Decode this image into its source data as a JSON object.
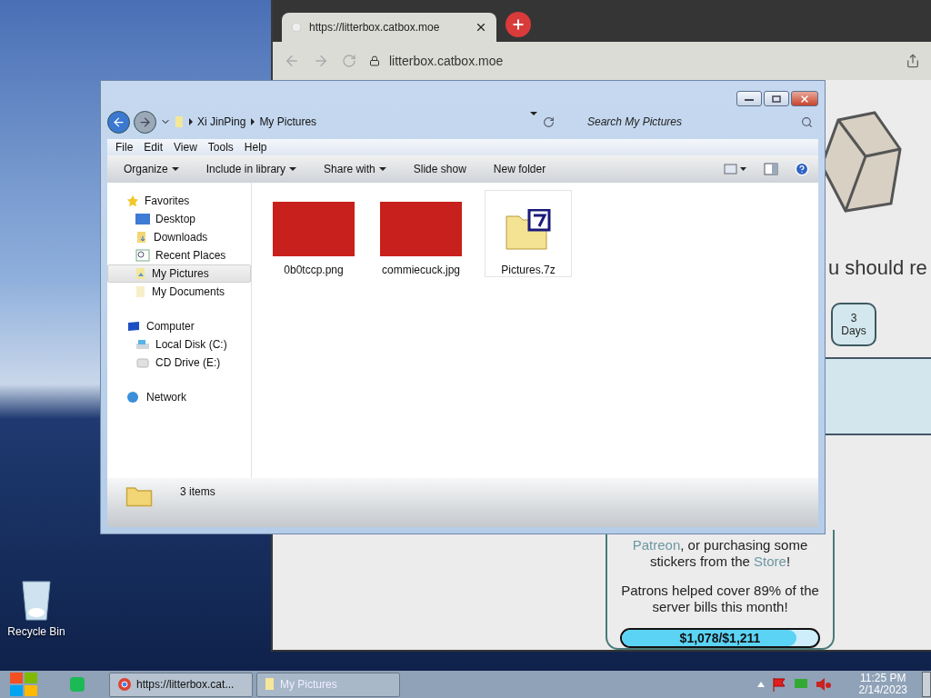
{
  "desktop": {
    "icons": [
      {
        "label": "Recycle Bin"
      }
    ]
  },
  "browser": {
    "tab": {
      "title": "https://litterbox.catbox.moe"
    },
    "address": "litterbox.catbox.moe",
    "page": {
      "heading": "u should re",
      "duration": {
        "number": "3",
        "unit": "Days"
      },
      "donation": {
        "segments": [
          {
            "kind": "link",
            "text": "Patreon"
          },
          {
            "kind": "plain",
            "text": ", or purchasing some stickers from the "
          },
          {
            "kind": "link",
            "text": "Store"
          },
          {
            "kind": "plain",
            "text": "!"
          }
        ],
        "patrons_note": "Patrons helped cover 89% of the server bills this month!",
        "progress": {
          "label": "$1,078/$1,211",
          "level": 0.89
        }
      }
    }
  },
  "explorer": {
    "breadcrumbs": [
      "Xi JinPing",
      "My Pictures"
    ],
    "search": {
      "placeholder": "Search My Pictures"
    },
    "menu": [
      "File",
      "Edit",
      "View",
      "Tools",
      "Help"
    ],
    "toolbar": [
      {
        "label": "Organize",
        "dropdown": true
      },
      {
        "label": "Include in library",
        "dropdown": true
      },
      {
        "label": "Share with",
        "dropdown": true
      },
      {
        "label": "Slide show",
        "dropdown": false
      },
      {
        "label": "New folder",
        "dropdown": false
      }
    ],
    "sidebar": [
      {
        "label": "Favorites",
        "kind": "favorites",
        "selected": false,
        "children": [
          {
            "label": "Desktop",
            "kind": "desktop",
            "selected": false
          },
          {
            "label": "Downloads",
            "kind": "downloads",
            "selected": false
          },
          {
            "label": "Recent Places",
            "kind": "recent",
            "selected": false
          },
          {
            "label": "My Pictures",
            "kind": "pictures",
            "selected": true
          },
          {
            "label": "My Documents",
            "kind": "documents",
            "selected": false
          }
        ]
      },
      {
        "label": "Computer",
        "kind": "computer",
        "selected": false,
        "children": [
          {
            "label": "Local Disk (C:)",
            "kind": "disk",
            "selected": false
          },
          {
            "label": "CD Drive (E:)",
            "kind": "cd",
            "selected": false
          }
        ]
      },
      {
        "label": "Network",
        "kind": "network",
        "selected": false
      }
    ],
    "files": [
      {
        "name": "0b0tccp.png",
        "kind": "image",
        "highlighted": false
      },
      {
        "name": "commiecuck.jpg",
        "kind": "image",
        "highlighted": false
      },
      {
        "name": "Pictures.7z",
        "kind": "archive",
        "highlighted": true
      }
    ],
    "status": "3 items"
  },
  "taskbar": {
    "tasks": [
      {
        "label": "https://litterbox.cat...",
        "kind": "browser",
        "selected": false
      },
      {
        "label": "My Pictures",
        "kind": "explorer",
        "selected": true
      }
    ],
    "time": "11:25 PM",
    "date": "2/14/2023"
  }
}
